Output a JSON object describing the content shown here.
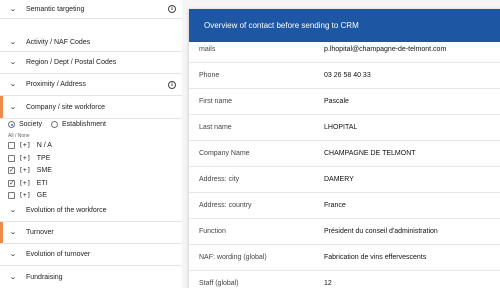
{
  "sidebar": {
    "items": [
      {
        "label": "Semantic targeting",
        "info": "i"
      },
      {
        "label": "Activity / NAF Codes"
      },
      {
        "label": "Region / Dept / Postal Codes"
      },
      {
        "label": "Proximity / Address",
        "info": "i"
      },
      {
        "label": "Company / site workforce"
      },
      {
        "label": "Evolution of the workforce"
      },
      {
        "label": "Turnover"
      },
      {
        "label": "Evolution of turnover"
      },
      {
        "label": "Fundraising"
      }
    ],
    "radio_society": "Society",
    "radio_establishment": "Establishment",
    "all_none": "All / None",
    "plus": "[+]",
    "checkboxes": [
      {
        "label": "N / A",
        "checked": false
      },
      {
        "label": "TPE",
        "checked": false
      },
      {
        "label": "SME",
        "checked": true
      },
      {
        "label": "ETI",
        "checked": true
      },
      {
        "label": "GE",
        "checked": false
      }
    ],
    "chevron": "⌄",
    "accent_color": "#f08a4b"
  },
  "card": {
    "title": "Overview of contact before sending to CRM",
    "header_color": "#1d57a4",
    "rows": [
      {
        "key": "mails",
        "value": "p.lhopital@champagne-de-telmont.com"
      },
      {
        "key": "Phone",
        "value": "03 26 58 40 33"
      },
      {
        "key": "First name",
        "value": "Pascale"
      },
      {
        "key": "Last name",
        "value": "LHOPITAL"
      },
      {
        "key": "Company Name",
        "value": "CHAMPAGNE DE TELMONT"
      },
      {
        "key": "Address: city",
        "value": "DAMERY"
      },
      {
        "key": "Address: country",
        "value": "France"
      },
      {
        "key": "Function",
        "value": "Président du conseil d'administration"
      },
      {
        "key": "NAF: wording (global)",
        "value": "Fabrication de vins effervescents"
      },
      {
        "key": "Staff (global)",
        "value": "12"
      }
    ]
  }
}
